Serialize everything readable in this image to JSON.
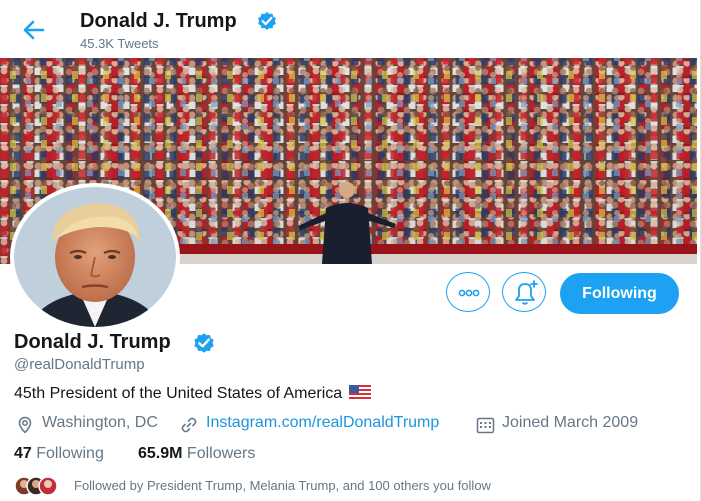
{
  "header": {
    "title": "Donald J. Trump",
    "tweet_count": "45.3K Tweets"
  },
  "profile": {
    "name": "Donald J. Trump",
    "handle": "@realDonaldTrump",
    "bio": "45th President of the United States of America",
    "location": "Washington, DC",
    "website": "Instagram.com/realDonaldTrump",
    "joined": "Joined March 2009",
    "following_count": "47",
    "following_label": "Following",
    "followers_count": "65.9M",
    "followers_label": "Followers",
    "followed_by": "Followed by President Trump, Melania Trump, and 100 others you follow"
  },
  "actions": {
    "following_button": "Following"
  },
  "icons": {
    "back": "arrow-left-icon",
    "verified": "verified-badge-icon",
    "more": "more-icon",
    "notify": "bell-plus-icon",
    "location": "location-pin-icon",
    "link": "link-icon",
    "calendar": "calendar-icon",
    "flag": "us-flag-icon"
  },
  "colors": {
    "accent": "#1da1f2",
    "link": "#1b95e0",
    "text": "#14171a",
    "muted": "#657786"
  }
}
